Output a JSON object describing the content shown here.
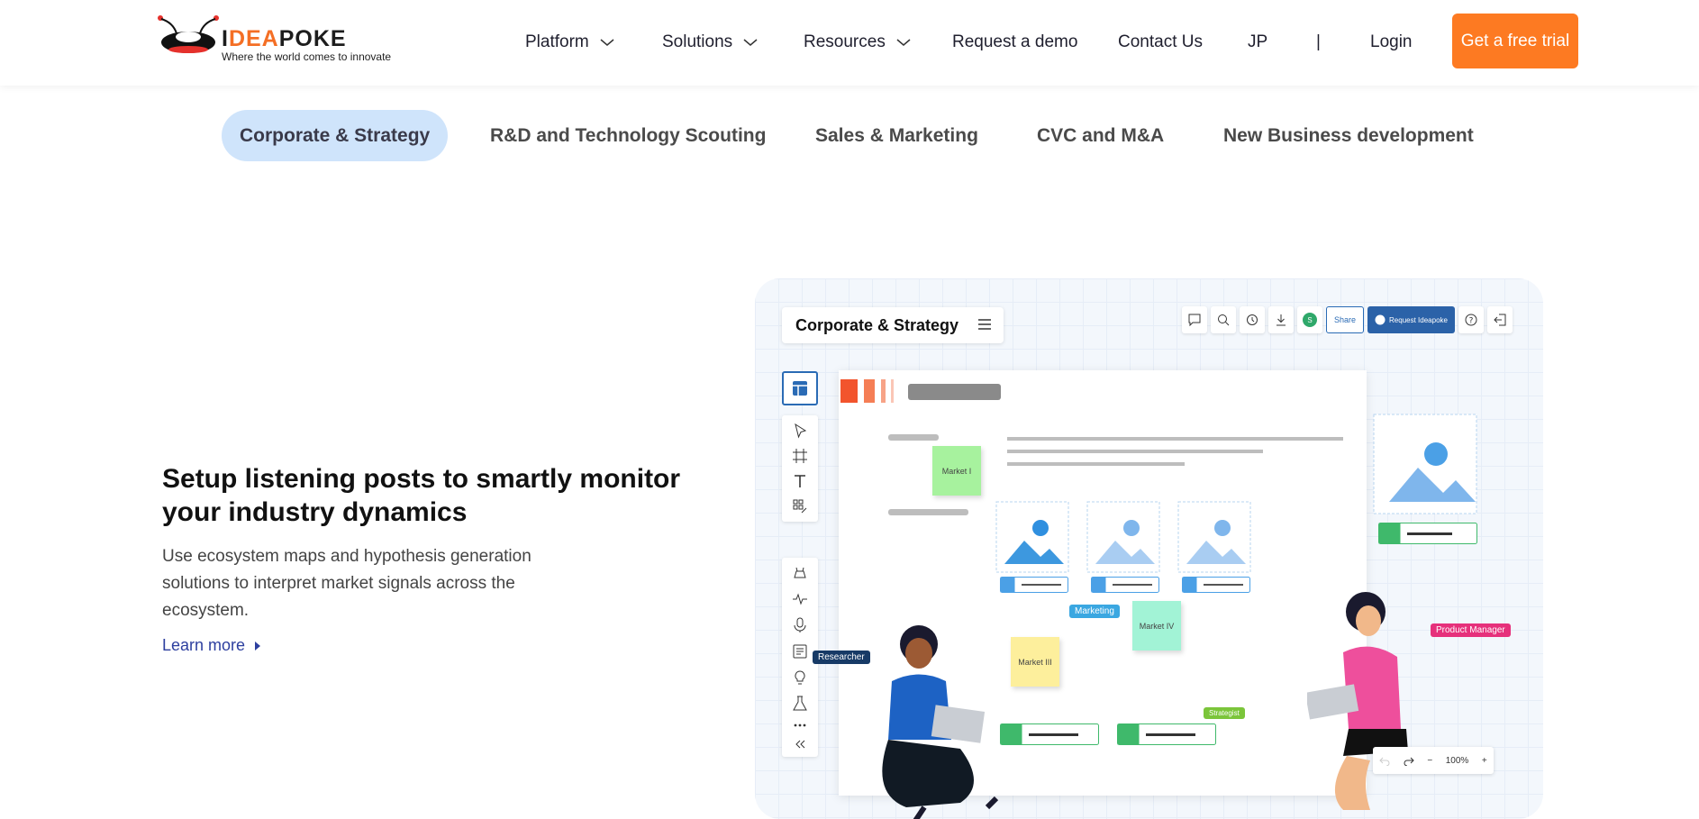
{
  "header": {
    "logo": {
      "brand_pre": "I",
      "brand_hl": "DEA",
      "brand_post": "POKE",
      "tagline": "Where the world comes to innovate"
    },
    "nav": [
      {
        "label": "Platform",
        "has_dropdown": true
      },
      {
        "label": "Solutions",
        "has_dropdown": true
      },
      {
        "label": "Resources",
        "has_dropdown": true
      },
      {
        "label": "Request a demo",
        "has_dropdown": false
      },
      {
        "label": "Contact Us",
        "has_dropdown": false
      },
      {
        "label": "JP",
        "has_dropdown": false
      },
      {
        "label": "|",
        "has_dropdown": false
      },
      {
        "label": "Login",
        "has_dropdown": false
      }
    ],
    "cta_label": "Get a free trial"
  },
  "tabs": [
    {
      "label": "Corporate & Strategy",
      "active": true
    },
    {
      "label": "R&D and Technology Scouting",
      "active": false
    },
    {
      "label": "Sales & Marketing",
      "active": false
    },
    {
      "label": "CVC and M&A",
      "active": false
    },
    {
      "label": "New Business development",
      "active": false
    }
  ],
  "content": {
    "headline": "Setup listening posts to smartly monitor your industry dynamics",
    "description": "Use ecosystem maps and hypothesis generation solutions to interpret market signals across the ecosystem.",
    "learn_more": "Learn more"
  },
  "illustration": {
    "board_title": "Corporate & Strategy",
    "share_label": "Share",
    "request_label": "Request Ideapoke",
    "avatar_letter": "S",
    "stickies": [
      "Market I",
      "Market III",
      "Market IV"
    ],
    "tags": {
      "marketing": "Marketing",
      "researcher": "Researcher",
      "product_manager": "Product Manager",
      "strategist": "Strategist"
    },
    "zoom": "100%"
  },
  "colors": {
    "accent_orange": "#fd7a22",
    "tab_active_bg": "#cfe4fb",
    "link_blue": "#2d3f9f",
    "tool_blue": "#2a6bb5"
  }
}
